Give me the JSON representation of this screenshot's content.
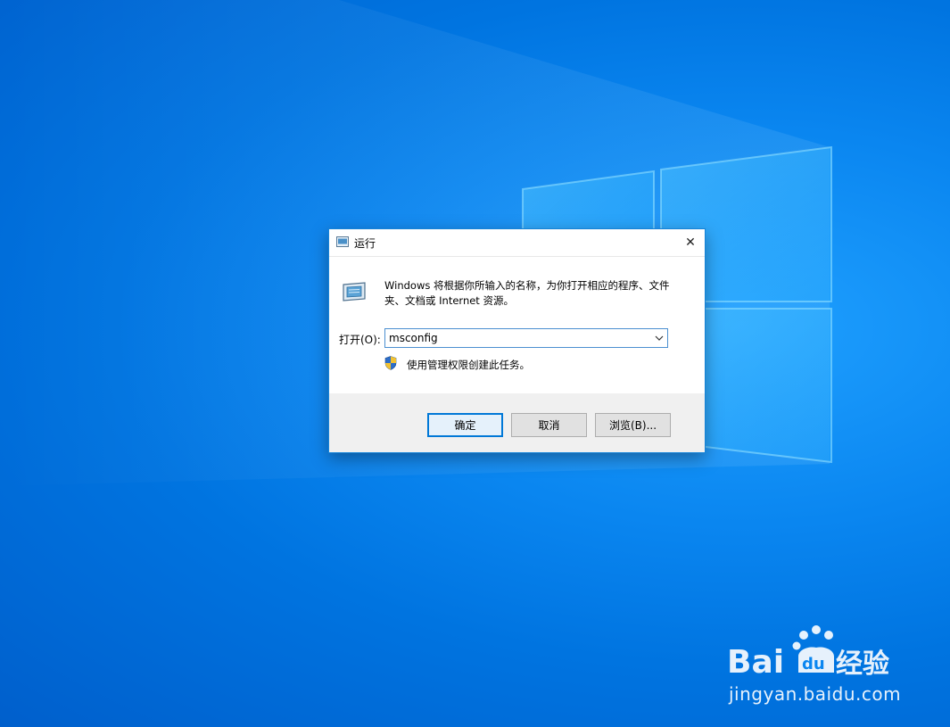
{
  "dialog": {
    "title": "运行",
    "description": "Windows 将根据你所输入的名称，为你打开相应的程序、文件夹、文档或 Internet 资源。",
    "open_label": "打开(O):",
    "open_value": "msconfig",
    "admin_note": "使用管理权限创建此任务。",
    "buttons": {
      "ok": "确定",
      "cancel": "取消",
      "browse": "浏览(B)..."
    },
    "icons": {
      "app": "run-app-icon",
      "close": "close-icon",
      "dropdown": "chevron-down-icon",
      "shield": "uac-shield-icon"
    }
  },
  "watermark": {
    "brand": "Bai du 经验",
    "url": "jingyan.baidu.com"
  },
  "colors": {
    "accent": "#0078d7",
    "desktop": "#0a86f0"
  }
}
